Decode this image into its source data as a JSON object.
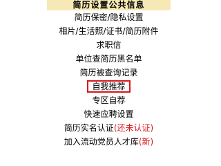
{
  "header": {
    "title": "简历设置公共信息"
  },
  "menu": {
    "items": [
      {
        "label": "简历保密/隐私设置"
      },
      {
        "label": "相片/生活照/证书/简历附件"
      },
      {
        "label": "求职信"
      },
      {
        "label": "单位查简历黑名单"
      },
      {
        "label": "简历被查询记录"
      },
      {
        "label": "自我推荐"
      },
      {
        "label": "专区自荐"
      },
      {
        "label": "快速应聘设置"
      },
      {
        "label": "简历实名认证",
        "paren_open": "(",
        "status": "还未认证",
        "paren_close": ")"
      },
      {
        "label": "加入流动党员人才库",
        "paren_open": "(",
        "status": "新",
        "paren_close": ")"
      }
    ]
  },
  "colors": {
    "header_bg": "#f6e9b5",
    "highlight_border": "#d9151b",
    "status_text": "#d9151b"
  }
}
